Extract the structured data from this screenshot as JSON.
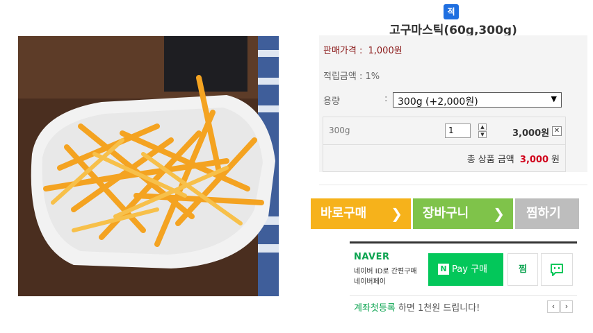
{
  "product": {
    "badge": "적",
    "title": "고구마스틱(60g,300g)",
    "price_label": "판매가격 : ",
    "price_value": "1,000원",
    "point_label": "적립금액 : 1%",
    "option_label": "용량",
    "option_colon": ":",
    "option_selected": "300g (+2,000원)"
  },
  "selected_option": {
    "name": "300g",
    "quantity": "1",
    "price": "3,000원",
    "total_label": "총 상품 금액",
    "total_amount": "3,000",
    "total_unit": "원"
  },
  "buttons": {
    "buy": "바로구매",
    "cart": "장바구니",
    "wish": "찜하기"
  },
  "naver_pay": {
    "brand": "NAVER",
    "sub1": "네이버 ID로 간편구매",
    "sub2": "네이버페이",
    "pay_label": "Pay 구매",
    "pay_logo": "N",
    "wish_label": "찜"
  },
  "promo": {
    "highlight": "계좌첫등록",
    "text": " 하면 1천원 드립니다!",
    "prev": "‹",
    "next": "›"
  },
  "colors": {
    "buy": "#f6b21b",
    "cart": "#7fc34a",
    "wish": "#bdbdbd",
    "naver_green": "#03c75a",
    "price_red": "#d0021b"
  }
}
